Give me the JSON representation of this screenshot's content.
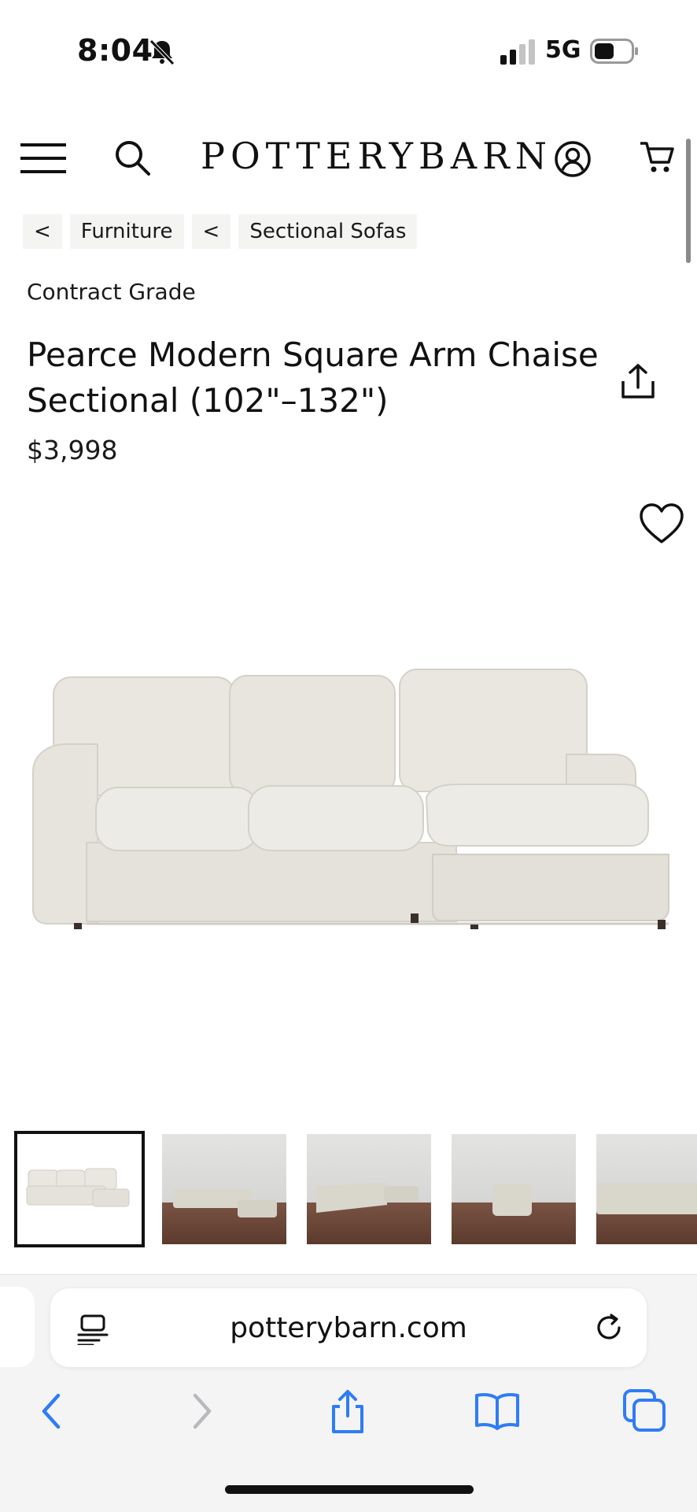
{
  "status_bar": {
    "time": "8:04",
    "network": "5G"
  },
  "header": {
    "logo_text": "POTTERYBARN"
  },
  "breadcrumbs": [
    {
      "back": "<",
      "label": "Furniture"
    },
    {
      "back": "<",
      "label": "Sectional Sofas"
    }
  ],
  "product": {
    "grade": "Contract Grade",
    "title": "Pearce Modern Square Arm Chaise Sectional (102\"–132\")",
    "price": "$3,998"
  },
  "gallery": {
    "thumbnail_count": 5,
    "selected_index": 0
  },
  "browser": {
    "url": "potterybarn.com"
  },
  "colors": {
    "ios_blue": "#2f7cf6",
    "ios_disabled": "#b9b9bd",
    "sofa_fabric": "#e9e7e0",
    "sofa_shadow": "#cfccc3",
    "breadcrumb_bg": "#f4f4f2"
  }
}
